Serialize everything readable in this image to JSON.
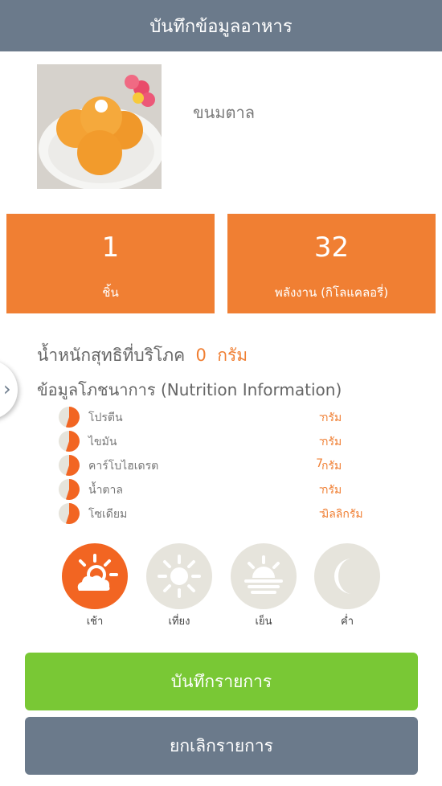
{
  "header": {
    "title": "บันทึกข้อมูลอาหาร"
  },
  "food": {
    "name": "ขนมตาล"
  },
  "stats": {
    "quantity": {
      "value": "1",
      "label": "ชิ้น"
    },
    "energy": {
      "value": "32",
      "label": "พลังงาน (กิโลแคลอรี่)"
    }
  },
  "weight": {
    "label": "น้ำหนักสุทธิที่บริโภค",
    "value": "0",
    "unit": "กรัม"
  },
  "nutrition": {
    "title": "ข้อมูลโภชนาการ (Nutrition Information)",
    "items": [
      {
        "name": "โปรตีน",
        "value": "-",
        "unit": "กรัม",
        "fraction": 0.55
      },
      {
        "name": "ไขมัน",
        "value": "-",
        "unit": "กรัม",
        "fraction": 0.55
      },
      {
        "name": "คาร์โบไฮเดรต",
        "value": "7",
        "unit": "กรัม",
        "fraction": 0.55
      },
      {
        "name": "น้ำตาล",
        "value": "-",
        "unit": "กรัม",
        "fraction": 0.55
      },
      {
        "name": "โซเดียม",
        "value": "-",
        "unit": "มิลลิกรัม",
        "fraction": 0.55
      }
    ]
  },
  "meals": [
    {
      "label": "เช้า",
      "icon": "sun-cloud-icon",
      "selected": true
    },
    {
      "label": "เที่ยง",
      "icon": "sun-icon",
      "selected": false
    },
    {
      "label": "เย็น",
      "icon": "sunset-icon",
      "selected": false
    },
    {
      "label": "ค่ำ",
      "icon": "moon-icon",
      "selected": false
    }
  ],
  "buttons": {
    "save": "บันทึกรายการ",
    "cancel": "ยกเลิกรายการ"
  },
  "colors": {
    "header": "#6b7a8b",
    "accent": "#f07f33",
    "meal_active": "#f26522",
    "save": "#79c835"
  }
}
